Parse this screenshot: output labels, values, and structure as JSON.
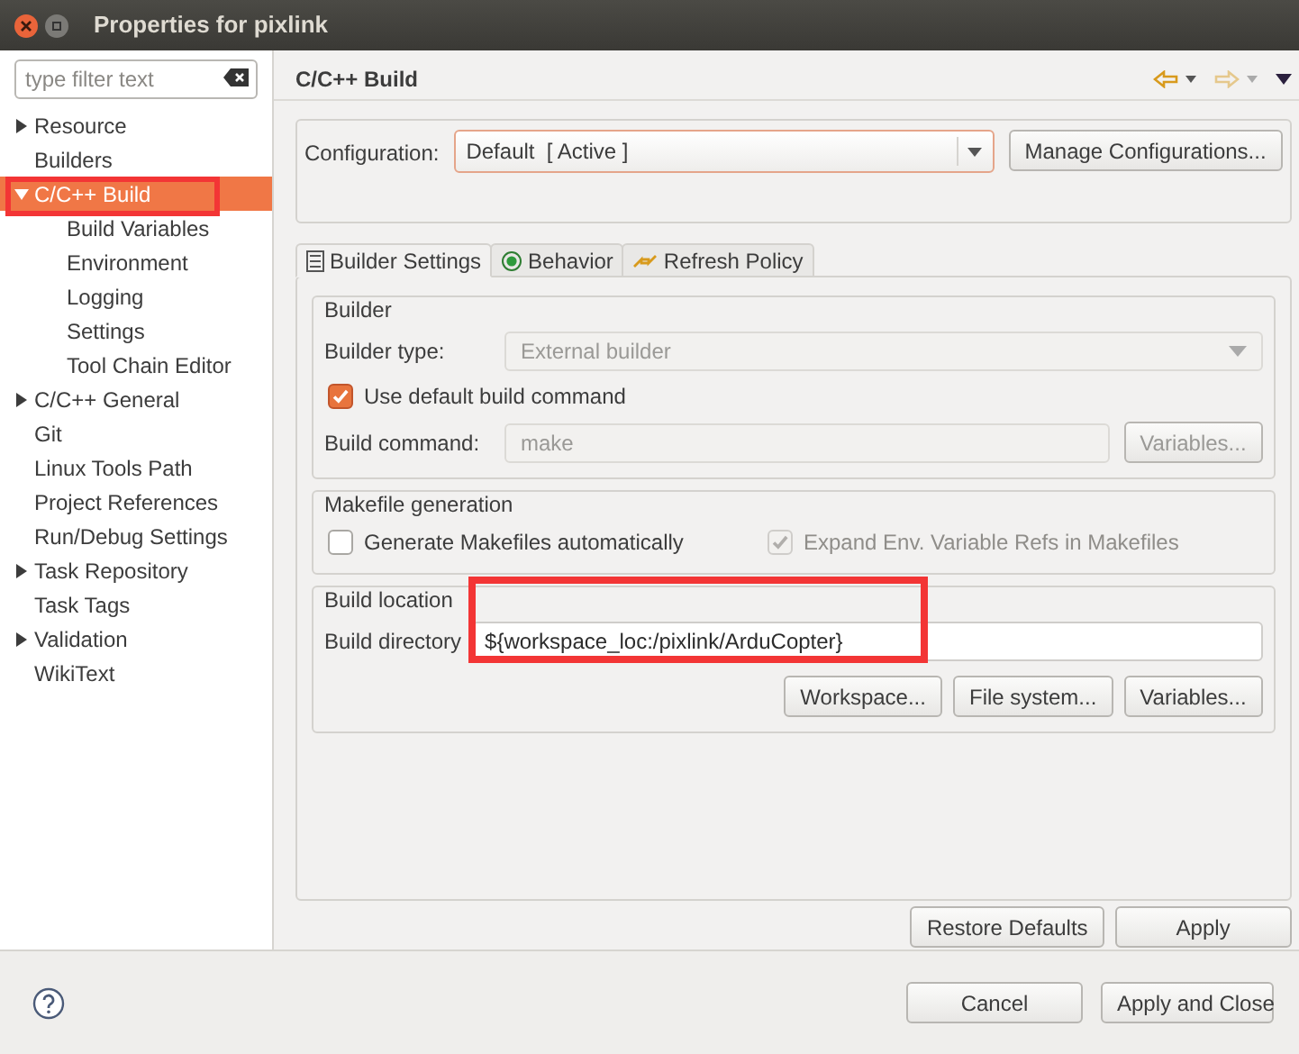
{
  "window": {
    "title": "Properties for pixlink"
  },
  "sidebar": {
    "filter": {
      "placeholder": "type filter text"
    },
    "items": [
      {
        "label": "Resource",
        "kind": "group",
        "expanded": false,
        "selected": false
      },
      {
        "label": "Builders",
        "kind": "page",
        "selected": false
      },
      {
        "label": "C/C++ Build",
        "kind": "group",
        "expanded": true,
        "selected": true,
        "children": [
          {
            "label": "Build Variables",
            "kind": "page",
            "selected": false
          },
          {
            "label": "Environment",
            "kind": "page",
            "selected": false
          },
          {
            "label": "Logging",
            "kind": "page",
            "selected": false
          },
          {
            "label": "Settings",
            "kind": "page",
            "selected": false
          },
          {
            "label": "Tool Chain Editor",
            "kind": "page",
            "selected": false
          }
        ]
      },
      {
        "label": "C/C++ General",
        "kind": "group",
        "expanded": false,
        "selected": false
      },
      {
        "label": "Git",
        "kind": "page",
        "selected": false
      },
      {
        "label": "Linux Tools Path",
        "kind": "page",
        "selected": false
      },
      {
        "label": "Project References",
        "kind": "page",
        "selected": false
      },
      {
        "label": "Run/Debug Settings",
        "kind": "page",
        "selected": false
      },
      {
        "label": "Task Repository",
        "kind": "group",
        "expanded": false,
        "selected": false
      },
      {
        "label": "Task Tags",
        "kind": "page",
        "selected": false
      },
      {
        "label": "Validation",
        "kind": "group",
        "expanded": false,
        "selected": false
      },
      {
        "label": "WikiText",
        "kind": "page",
        "selected": false
      }
    ]
  },
  "page": {
    "title": "C/C++ Build",
    "configuration": {
      "label": "Configuration:",
      "value": "Default  [ Active ]",
      "button": "Manage Configurations..."
    },
    "tabs": [
      {
        "label": "Builder Settings",
        "selected": true
      },
      {
        "label": "Behavior",
        "selected": false
      },
      {
        "label": "Refresh Policy",
        "selected": false
      }
    ],
    "builder": {
      "title": "Builder",
      "type_label": "Builder type:",
      "type_value": "External builder",
      "use_default": {
        "label": "Use default build command",
        "checked": true
      },
      "command_label": "Build command:",
      "command_value": "make",
      "variables_button": "Variables..."
    },
    "makefile": {
      "title": "Makefile generation",
      "generate": {
        "label": "Generate Makefiles automatically",
        "checked": false
      },
      "expand": {
        "label": "Expand Env. Variable Refs in Makefiles",
        "checked": true,
        "disabled": true
      }
    },
    "location": {
      "title": "Build location",
      "dir_label": "Build directory",
      "dir_value": "${workspace_loc:/pixlink/ArduCopter}",
      "buttons": [
        "Workspace...",
        "File system...",
        "Variables..."
      ]
    },
    "buttons": [
      "Restore Defaults",
      "Apply"
    ]
  },
  "footer": {
    "buttons": [
      "Cancel",
      "Apply and Close"
    ]
  }
}
